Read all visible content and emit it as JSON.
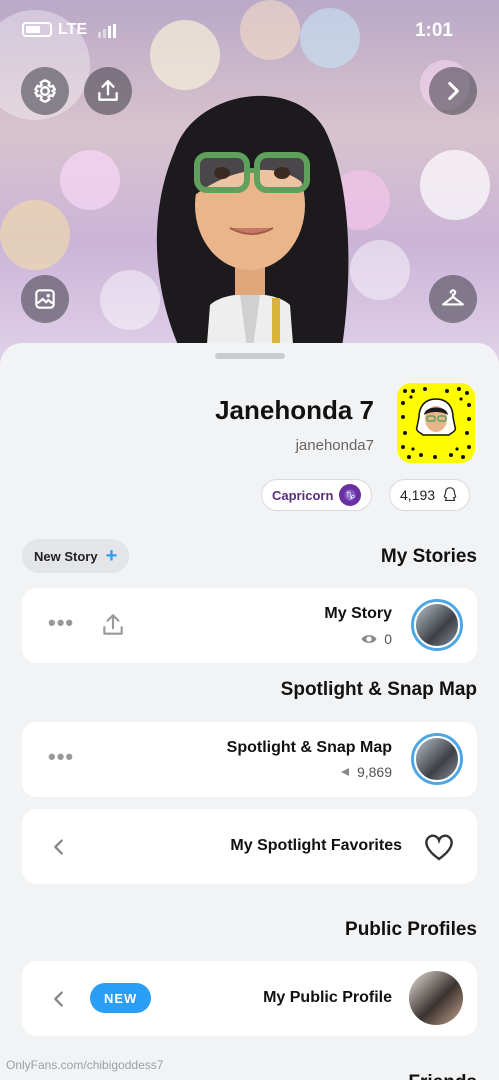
{
  "status_bar": {
    "time": "1:01",
    "network": "LTE"
  },
  "profile": {
    "display_name": "Janehonda 7",
    "username": "janehonda7",
    "snap_score": "4,193",
    "zodiac": "Capricorn",
    "zodiac_symbol": "♑"
  },
  "stories": {
    "title": "My Stories",
    "new_story_label": "New Story",
    "my_story": {
      "title": "My Story",
      "views": "0"
    }
  },
  "spotlight": {
    "title": "Spotlight & Snap Map",
    "item": {
      "title": "Spotlight & Snap Map",
      "views": "9,869"
    },
    "favorites_label": "My Spotlight Favorites"
  },
  "public_profiles": {
    "title": "Public Profiles",
    "item_label": "My Public Profile",
    "badge": "NEW"
  },
  "next_section_title": "Friends",
  "watermark": "OnlyFans.com/chibigoddess7",
  "colors": {
    "accent": "#2a9df4",
    "snapcode_yellow": "#fffc00"
  }
}
